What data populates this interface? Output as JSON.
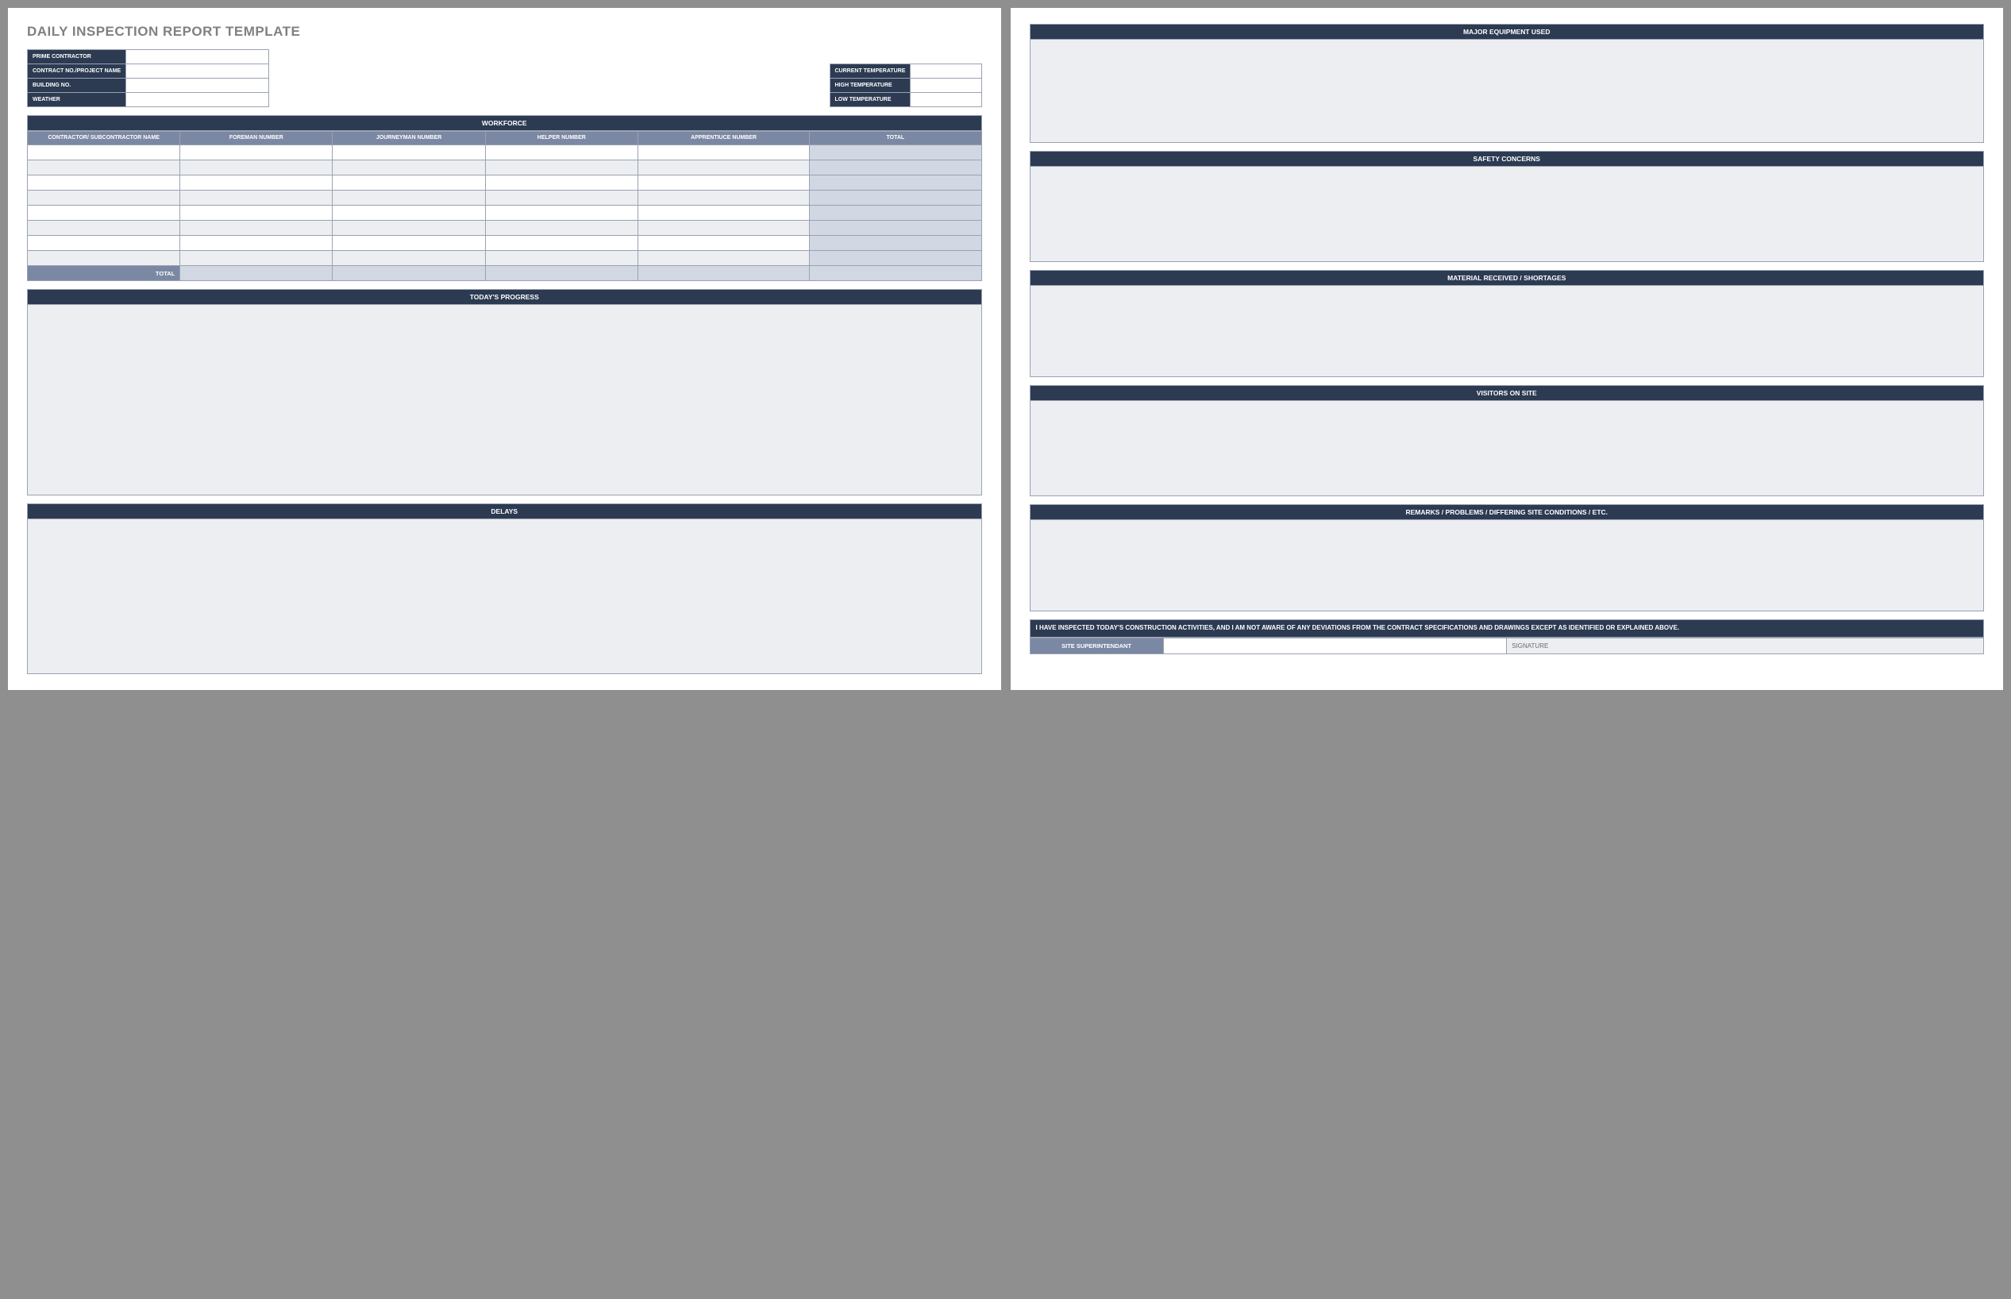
{
  "title": "DAILY INSPECTION REPORT TEMPLATE",
  "info_left": {
    "prime_contractor": "PRIME CONTRACTOR",
    "contract_no": "CONTRACT NO./PROJECT NAME",
    "building_no": "BUILDING NO.",
    "weather": "WEATHER"
  },
  "info_right": {
    "current_temp": "CURRENT TEMPERATURE",
    "high_temp": "HIGH TEMPERATURE",
    "low_temp": "LOW TEMPERATURE"
  },
  "workforce": {
    "header": "WORKFORCE",
    "cols": {
      "contractor": "CONTRACTOR/ SUBCONTRACTOR NAME",
      "foreman": "FOREMAN NUMBER",
      "journeyman": "JOURNEYMAN NUMBER",
      "helper": "HELPER NUMBER",
      "apprentice": "APPRENTIUCE NUMBER",
      "total": "TOTAL"
    },
    "total_label": "TOTAL"
  },
  "sections": {
    "progress": "TODAY'S PROGRESS",
    "delays": "DELAYS",
    "equipment": "MAJOR EQUIPMENT USED",
    "safety": "SAFETY CONCERNS",
    "material": "MATERIAL RECEIVED / SHORTAGES",
    "visitors": "VISITORS ON SITE",
    "remarks": "REMARKS / PROBLEMS / DIFFERING SITE CONDITIONS / ETC."
  },
  "certification": "I HAVE INSPECTED TODAY'S CONSTRUCTION ACTIVITIES, AND I AM NOT AWARE OF ANY DEVIATIONS FROM THE CONTRACT SPECIFICATIONS AND DRAWINGS EXCEPT AS IDENTIFIED OR EXPLAINED ABOVE.",
  "signature": {
    "super": "SITE SUPERINTENDANT",
    "sig": "SIGNATURE"
  }
}
